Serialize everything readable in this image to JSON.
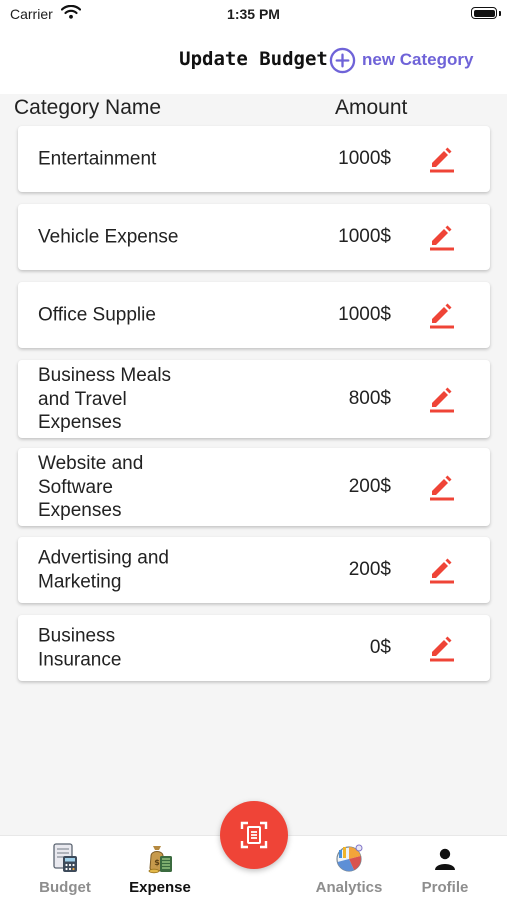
{
  "status_bar": {
    "carrier": "Carrier",
    "time": "1:35 PM"
  },
  "header": {
    "title": "Update Budget",
    "new_category_label": "new Category",
    "new_category_icon": "plus-circle-icon"
  },
  "columns": {
    "name": "Category Name",
    "amount": "Amount"
  },
  "categories": [
    {
      "name": "Entertainment",
      "amount": "1000$"
    },
    {
      "name": "Vehicle Expense",
      "amount": "1000$"
    },
    {
      "name": "Office Supplie",
      "amount": "1000$"
    },
    {
      "name": "Business Meals and Travel Expenses",
      "amount": "800$"
    },
    {
      "name": "Website and Software Expenses",
      "amount": "200$"
    },
    {
      "name": "Advertising and Marketing",
      "amount": "200$"
    },
    {
      "name": "Business Insurance",
      "amount": "0$"
    }
  ],
  "tabs": [
    {
      "label": "Budget",
      "icon": "budget-calculator-icon"
    },
    {
      "label": "Expense",
      "icon": "expense-money-icon"
    },
    {
      "label": "Analytics",
      "icon": "analytics-chart-icon"
    },
    {
      "label": "Profile",
      "icon": "person-icon"
    }
  ],
  "active_tab": "Expense",
  "fab_icon": "scan-receipt-icon",
  "colors": {
    "accent_purple": "#6f63d8",
    "edit_red": "#ef4437",
    "fab_red": "#ef4437",
    "background": "#f5f5f5"
  }
}
